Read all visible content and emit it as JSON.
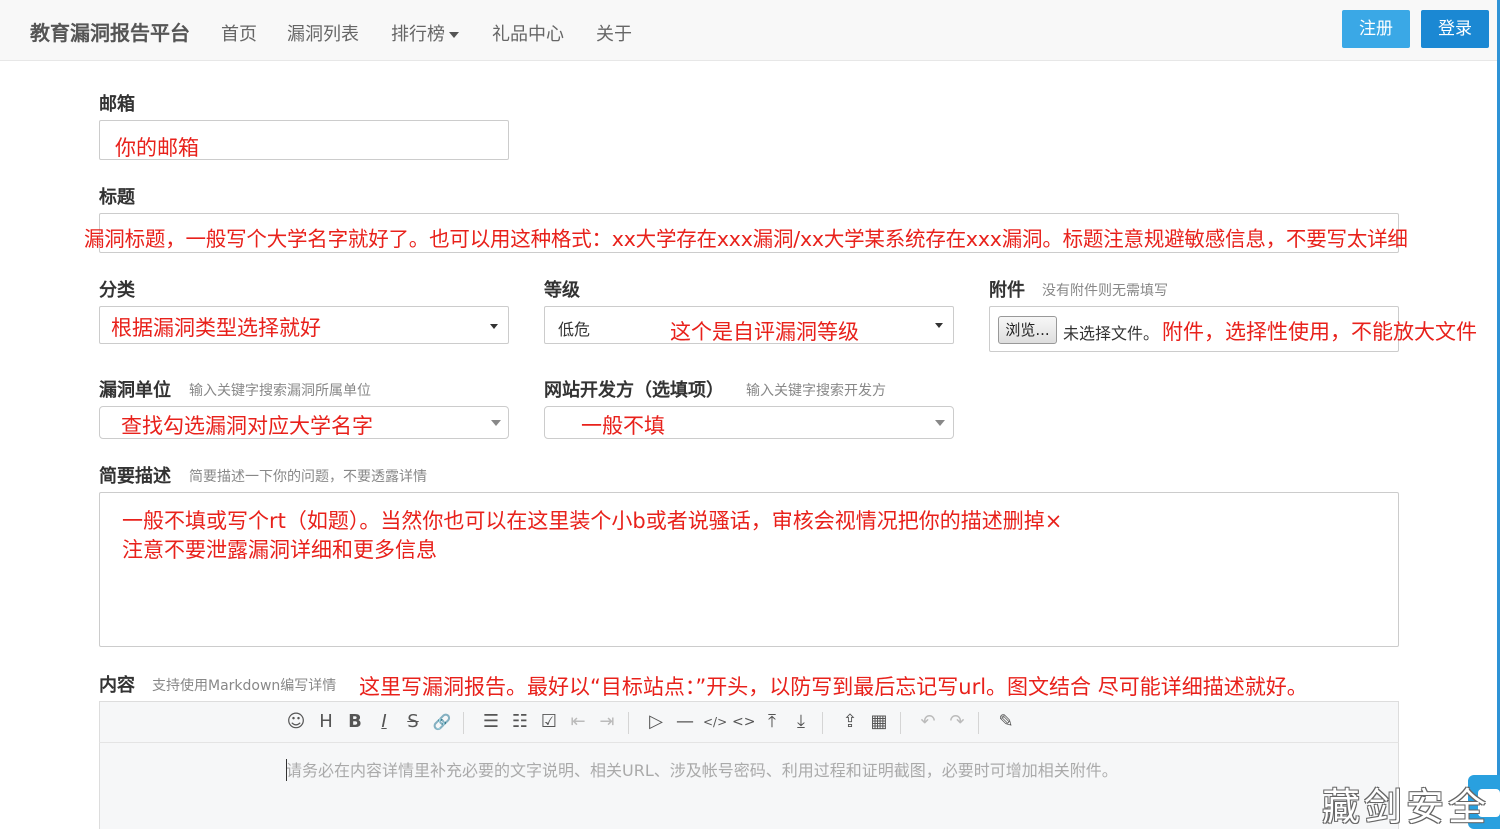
{
  "nav": {
    "brand": "教育漏洞报告平台",
    "items": [
      "首页",
      "漏洞列表",
      "排行榜",
      "礼品中心",
      "关于"
    ],
    "register": "注册",
    "login": "登录"
  },
  "form": {
    "email": {
      "label": "邮箱",
      "annotation": "你的邮箱"
    },
    "title": {
      "label": "标题",
      "annotation": "漏洞标题，一般写个大学名字就好了。也可以用这种格式：xx大学存在xxx漏洞/xx大学某系统存在xxx漏洞。标题注意规避敏感信息，不要写太详细"
    },
    "category": {
      "label": "分类",
      "annotation": "根据漏洞类型选择就好"
    },
    "level": {
      "label": "等级",
      "value": "低危",
      "annotation": "这个是自评漏洞等级"
    },
    "attachment": {
      "label": "附件",
      "hint": "没有附件则无需填写",
      "browse": "浏览...",
      "no_file": "未选择文件。",
      "annotation": "附件，选择性使用，不能放大文件"
    },
    "unit": {
      "label": "漏洞单位",
      "hint": "输入关键字搜索漏洞所属单位",
      "annotation": "查找勾选漏洞对应大学名字"
    },
    "developer": {
      "label": "网站开发方（选填项）",
      "hint": "输入关键字搜索开发方",
      "annotation": "一般不填"
    },
    "summary": {
      "label": "简要描述",
      "hint": "简要描述一下你的问题，不要透露详情",
      "annotation_line1": "一般不填或写个rt（如题）。当然你也可以在这里装个小b或者说骚话，审核会视情况把你的描述删掉×",
      "annotation_line2": "注意不要泄露漏洞详细和更多信息"
    },
    "content": {
      "label": "内容",
      "hint": "支持使用Markdown编写详情",
      "annotation": "这里写漏洞报告。最好以“目标站点：”开头，以防写到最后忘记写url。图文结合 尽可能详细描述就好。",
      "placeholder": "请务必在内容详情里补充必要的文字说明、相关URL、涉及帐号密码、利用过程和证明截图，必要时可增加相关附件。"
    }
  },
  "toolbar": {
    "emoji": "☺",
    "heading": "H",
    "bold": "B",
    "italic": "I",
    "strike": "S",
    "link": "🔗",
    "ul": "☰",
    "ol": "☷",
    "check": "☑",
    "outdent": "⇤",
    "indent": "⇥",
    "quote": "▷",
    "hr": "—",
    "code": "</>",
    "inline_code": "<>",
    "top": "⤒",
    "bottom": "⤓",
    "upload": "⇪",
    "table": "▦",
    "undo": "↶",
    "redo": "↷",
    "edit": "✎"
  },
  "watermark": "藏剑安全"
}
